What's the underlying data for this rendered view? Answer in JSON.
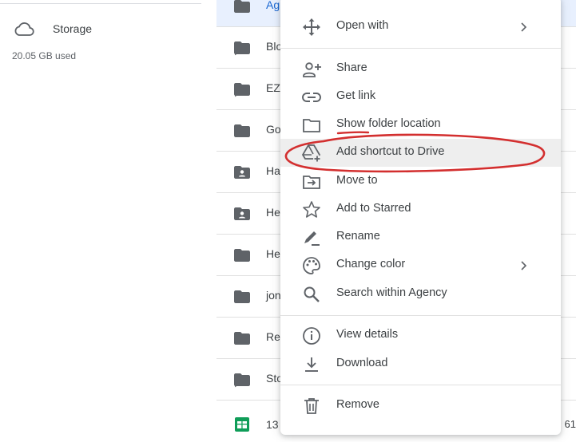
{
  "sidebar": {
    "storage_label": "Storage",
    "storage_used": "20.05 GB used"
  },
  "files": [
    {
      "name": "Ag",
      "icon": "folder-icon",
      "selected": true
    },
    {
      "name": "Blo",
      "icon": "shortcut-folder-icon"
    },
    {
      "name": "EZ",
      "icon": "shortcut-folder-icon"
    },
    {
      "name": "Go",
      "icon": "folder-icon"
    },
    {
      "name": "Ha",
      "icon": "shared-folder-icon"
    },
    {
      "name": "He",
      "icon": "shared-folder-icon"
    },
    {
      "name": "He",
      "icon": "folder-icon"
    },
    {
      "name": "jon",
      "icon": "folder-icon"
    },
    {
      "name": "Re",
      "icon": "folder-icon"
    },
    {
      "name": "Sto",
      "icon": "shortcut-folder-icon"
    },
    {
      "name": "13",
      "icon": "sheets-icon",
      "extra": "61"
    }
  ],
  "menu": {
    "open_with": "Open with",
    "share": "Share",
    "get_link": "Get link",
    "show_folder_location": "Show folder location",
    "add_shortcut": "Add shortcut to Drive",
    "move_to": "Move to",
    "add_to_starred": "Add to Starred",
    "rename": "Rename",
    "change_color": "Change color",
    "search_within": "Search within Agency",
    "view_details": "View details",
    "download": "Download",
    "remove": "Remove"
  },
  "colors": {
    "icon_gray": "#5f6368",
    "annotation_red": "#d32f2f",
    "highlight": "#eeeeee",
    "selected_row": "#e8f0fe",
    "sheets_green": "#0f9d58"
  }
}
